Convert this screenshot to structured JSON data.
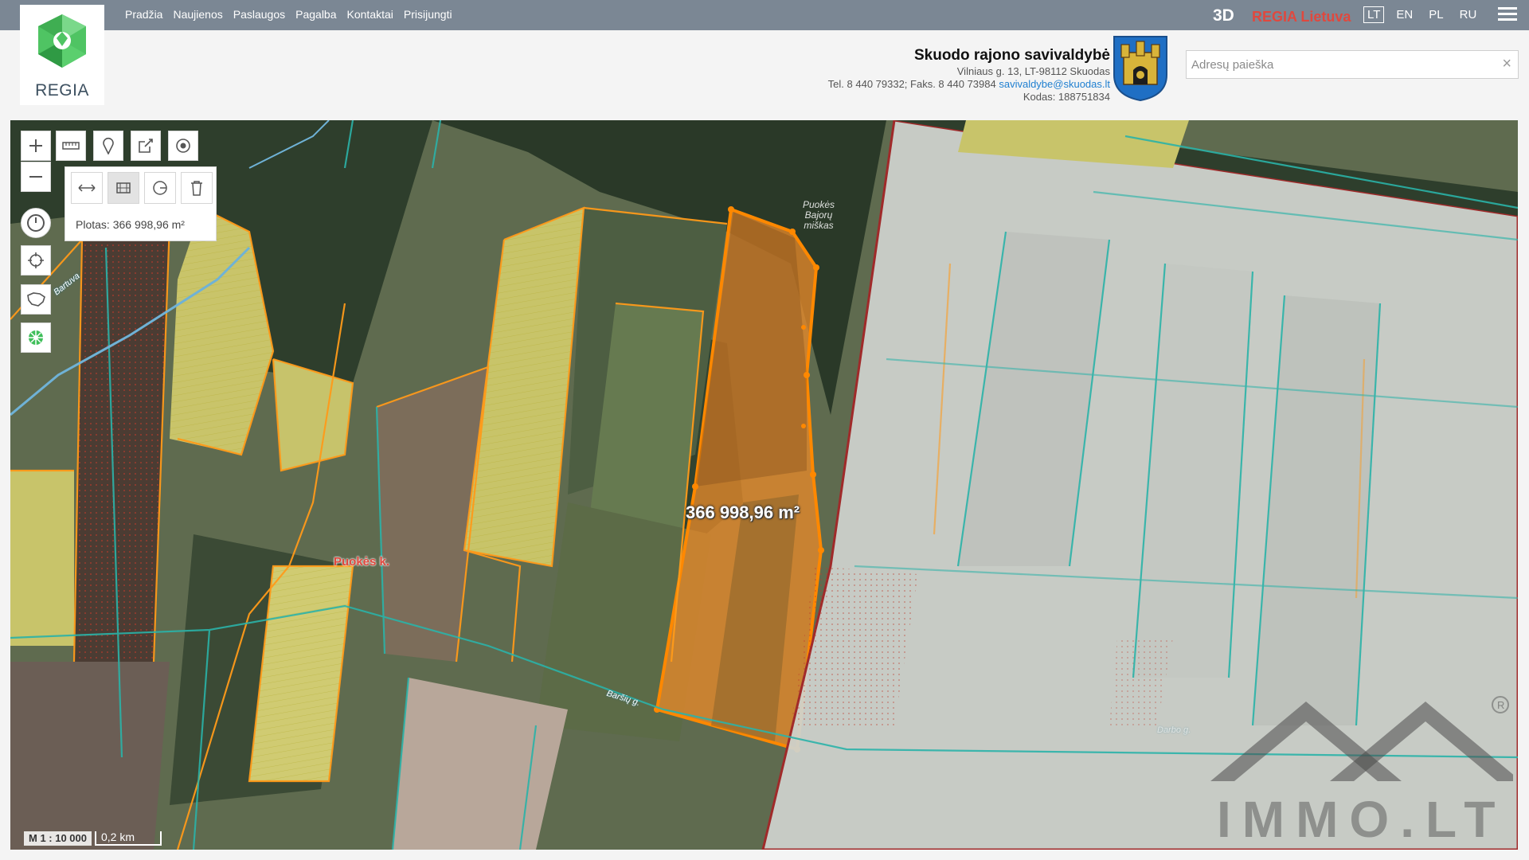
{
  "nav": {
    "items": [
      "Pradžia",
      "Naujienos",
      "Paslaugos",
      "Pagalba",
      "Kontaktai",
      "Prisijungti"
    ],
    "btn_3d": "3D",
    "brand": "REGIA Lietuva",
    "languages": [
      "LT",
      "EN",
      "PL",
      "RU"
    ],
    "active_language": "LT"
  },
  "logo": {
    "text": "REGIA"
  },
  "municipality": {
    "name": "Skuodo rajono savivaldybė",
    "address": "Vilniaus g. 13, LT-98112 Skuodas",
    "phone": "Tel. 8 440 79332; Faks. 8 440 73984",
    "email": "savivaldybe@skuodas.lt",
    "code": "Kodas: 188751834"
  },
  "search": {
    "placeholder": "Adresų paieška",
    "value": "",
    "clear_icon": "×"
  },
  "map": {
    "measurement": "Plotas: 366 998,96 m²",
    "area_label": "366 998,96 m²",
    "place_label": "Puokės k.",
    "forest_label": "Puokės Bajorų miškas",
    "road_label_left": "Bartuva",
    "road_label_bottom": "Baršių g.",
    "road_label_right": "Darbo g.",
    "scale_ratio": "M 1 : 10 000",
    "scale_bar": "0,2 km",
    "watermark": "IMMO.LT"
  },
  "icons": {
    "zoom_in": "plus-icon",
    "zoom_out": "minus-icon",
    "history": "clock-icon",
    "locate": "crosshair-icon",
    "country": "lithuania-map-icon",
    "layers": "regia-layers-icon",
    "measure": "ruler-icon",
    "marker": "map-pin-icon",
    "share": "share-icon",
    "gps": "target-icon",
    "measure_distance": "measure-distance-icon",
    "measure_area": "measure-area-icon",
    "measure_circle": "measure-radius-icon",
    "delete": "trash-icon"
  },
  "colors": {
    "topbar": "#7b8794",
    "brand": "#e0483e",
    "parcel_orange": "#ff8c00",
    "parcel_cyan": "#2aa6a0",
    "highlight": "#f08a24"
  }
}
